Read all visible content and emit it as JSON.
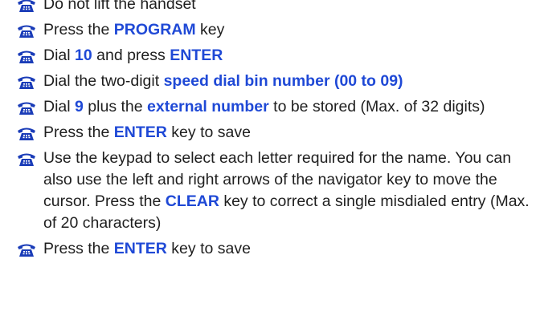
{
  "steps": [
    {
      "parts": [
        {
          "text": "Do not lift the handset"
        }
      ]
    },
    {
      "parts": [
        {
          "text": "Press the "
        },
        {
          "text": "PROGRAM",
          "hl": true
        },
        {
          "text": " key"
        }
      ]
    },
    {
      "parts": [
        {
          "text": "Dial "
        },
        {
          "text": "10",
          "hl": true
        },
        {
          "text": " and press "
        },
        {
          "text": "ENTER",
          "hl": true
        }
      ]
    },
    {
      "parts": [
        {
          "text": "Dial the two-digit "
        },
        {
          "text": "speed dial bin number (00 to 09)",
          "hl": true
        }
      ]
    },
    {
      "parts": [
        {
          "text": "Dial "
        },
        {
          "text": "9",
          "hl": true
        },
        {
          "text": " plus the "
        },
        {
          "text": "external number",
          "hl": true
        },
        {
          "text": " to be stored (Max. of 32 digits)"
        }
      ]
    },
    {
      "parts": [
        {
          "text": "Press the "
        },
        {
          "text": "ENTER",
          "hl": true
        },
        {
          "text": " key to save"
        }
      ]
    },
    {
      "parts": [
        {
          "text": "Use the keypad to select each letter required for the name.  You can also use the left and right arrows of the navigator key to move the cursor.  Press the "
        },
        {
          "text": "CLEAR",
          "hl": true
        },
        {
          "text": " key to correct a single misdialed entry (Max. of 20 characters)"
        }
      ]
    },
    {
      "parts": [
        {
          "text": "Press the "
        },
        {
          "text": "ENTER",
          "hl": true
        },
        {
          "text": " key to save"
        }
      ]
    }
  ],
  "bullet_icon": "telephone-icon",
  "colors": {
    "highlight": "#1f49d6",
    "icon": "#1a3cb8",
    "text": "#1f1f1f"
  }
}
